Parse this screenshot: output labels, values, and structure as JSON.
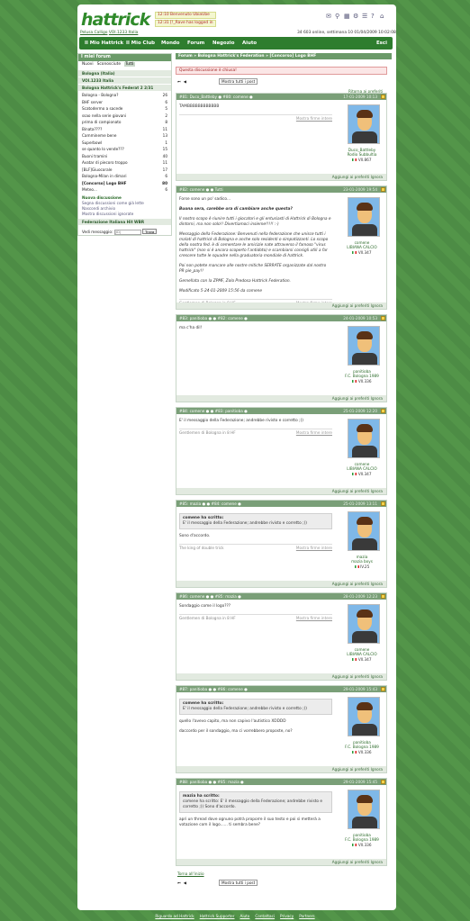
{
  "header": {
    "logo": "hattrick",
    "news": [
      "12:10 Benvenuto UbiaUbe",
      "12:31 [!_Rave has logged in"
    ],
    "user_line": {
      "name": "Pelusa Calligo",
      "team": "VOI.1233 Italia"
    },
    "online_text": "34 603 online, settimana 10 01/04/2009 10:02:08"
  },
  "nav": {
    "items": [
      "Il Mio Hattrick",
      "Il Mio Club",
      "Mondo",
      "Forum",
      "Negozio",
      "Aiuto"
    ],
    "exit": "Esci"
  },
  "sidebar": {
    "title": "I miei forum",
    "filters": [
      "Nuovi",
      "Sconosciute",
      "Tutti"
    ],
    "groups": [
      "Bologna (Italia)",
      "VOI.1233 Italia",
      "Bologna Hattrick's Federat 2 2/31"
    ],
    "threads": [
      {
        "t": "Bologna - Bologna?",
        "n": "26"
      },
      {
        "t": "BHF server",
        "n": "6"
      },
      {
        "t": "Scatodermo a sacede",
        "n": "5"
      },
      {
        "t": "ssao nella serie giovani",
        "n": "2"
      },
      {
        "t": "prima di campionato",
        "n": "8"
      },
      {
        "t": "Binata????",
        "n": "11"
      },
      {
        "t": "Cammineme bene",
        "n": "13"
      },
      {
        "t": "Superbowl",
        "n": "1"
      },
      {
        "t": "se quanto lo vende???",
        "n": "15"
      },
      {
        "t": "Buoni tramini",
        "n": "40"
      },
      {
        "t": "Avatar di piecoro troppo",
        "n": "11"
      },
      {
        "t": "[BLF]Giuocorale",
        "n": "17"
      },
      {
        "t": "Bologna-Milan in dimari",
        "n": "6"
      },
      {
        "t": "[Concorso] Logo BHF",
        "n": "80"
      },
      {
        "t": "Meteo...",
        "n": "6"
      }
    ],
    "links": [
      "Nuova discussione",
      "Segna discussioni come già lette",
      "Nascondi archivio",
      "Mostra discussioni ignorate"
    ],
    "fed": "Federazione Italiana Hit WBR",
    "vedi": "Vedi messaggio:",
    "vedi_ph": "(ID)",
    "vedi_btn": "Trova"
  },
  "breadcrumb": "Forum » Bologna Hattrick's Federation » [Concorso] Logo BHF",
  "alert": "Questa discussione è chiusa!",
  "pager": {
    "label": "Mostra tutti i post",
    "top": "Ritorna ai preferiti"
  },
  "posts": [
    {
      "h": "#81: Duco_Battleby ● #80: comene ●",
      "d": "17-01-2009 10:13",
      "body": [
        "TAMBBBBBBBBBBBB"
      ],
      "sig": "",
      "name": "Duco_Battleby",
      "team": "Rodio Subbultia",
      "team2": "VII.867",
      "foot": "Aggiungi ai preferiti  Ignora"
    },
    {
      "h": "#82: comene ● ● Tutti",
      "d": "23-01-2009 19:54",
      "body": [
        "Forse sono un po' sadico...",
        "Buona sera, carebbe ora di cambiare anche questa?",
        "Il nostro scopo è riunire tutti i giocatori e gli entusiasti di Hattrick di Bologna e dintorni, ma non solo!! Divertiamoci insieme!!!!! :-)",
        "Messaggio della Federazione: Benvenuti nella federazione che unisce tutti i malati di hattrick di Bologna e anche solo residenti o simpatizzanti. Lo scopo della nostra fed. è di cementare le amicizie nate attraverso il famoso \"virus hattrick\" (non si è ancora scoperto l'antidoto) e scambiarsi consigli utili a far crescere tutte le squadre nella graduatoria mondiale di hattrick.",
        "Poi non potete mancare alle nostre mitiche SERRATE organizzate dal nostro PR pie_pay!!",
        "Gemellata con la ZPMF, Zolo Predosa Hattrick Federation.",
        "Modificato 5-24-01-2009 15:56 da comene"
      ],
      "sig": "Gentlemen di Bologna in 8 HF",
      "name": "comene",
      "team": "LIBIANA CALCIO",
      "team2": "VII.347",
      "foot": "Aggiungi ai preferiti  Ignora"
    },
    {
      "h": "#83: panitioba ● ● #82: comene ●",
      "d": "24-01-2009 10:53",
      "body": [
        "ma c'ha dil!"
      ],
      "sig": "",
      "name": "panitioba",
      "team": "F.C. Bologna 1989",
      "team2": "VII.336",
      "foot": "Aggiungi ai preferiti  Ignora"
    },
    {
      "h": "#84: comene ● ● #83: panitioba ●",
      "d": "25-01-2009 12:20",
      "body": [
        "E' il messaggio della Federazione; andrebbe rivisto e corretto ;))"
      ],
      "sig": "Gentlemen di Bologna in 8 HF",
      "name": "comene",
      "team": "LIBIANA CALCIO",
      "team2": "VII.347",
      "foot": "Aggiungi ai preferiti  Ignora"
    },
    {
      "h": "#85: mazia ● ● #84: comene ●",
      "d": "25-01-2009 13:11",
      "quote": {
        "t": "comene ha scritto:",
        "b": "E' il messaggio della Federazione; andrebbe rivisto e corretto ;))"
      },
      "body": [
        "Sono d'accordo."
      ],
      "sig": "The king of double trick",
      "name": "mazia",
      "team": "mazia boys",
      "team2": "IV.25",
      "foot": "Aggiungi ai preferiti  Ignora"
    },
    {
      "h": "#86: comene ● ● #85: mazia ●",
      "d": "28-01-2009 12:23",
      "body": [
        "Sondaggio come il logo???"
      ],
      "sig": "Gentlemen di Bologna in 8 HF",
      "name": "comene",
      "team": "LIBIANA CALCIO",
      "team2": "VII.347",
      "foot": "Aggiungi ai preferiti  Ignora"
    },
    {
      "h": "#87: panitioba ● ● #86: comene ●",
      "d": "29-01-2009 15:43",
      "quote": {
        "t": "comene ha scritto:",
        "b": "E' il messaggio della Federazione; andrebbe rivisto e corretto ;))"
      },
      "body": [
        "quello l'avevo capito, ma non capivo l'autistico XDDDD",
        "daccordo per il sondaggio, ma ci vorrebbero proposte, no?"
      ],
      "sig": "",
      "name": "panitioba",
      "team": "F.C. Bologna 1989",
      "team2": "VII.336",
      "foot": "Aggiungi ai preferiti  Ignora"
    },
    {
      "h": "#88: panitioba ● ● #85: mazia ●",
      "d": "29-01-2009 15:45",
      "quote": {
        "t": "mazia ha scritto:",
        "b": "comene ha scritto: E' il messaggio della Federazione; andrebbe rivisto e corretto ;)) Sono d'accordo."
      },
      "body": [
        "apri un thread dove ognuno potrà proporre il suo testo e poi si metterà a votazione com il logo...... ti sembra bene?"
      ],
      "sig": "",
      "name": "panitioba",
      "team": "F.C. Bologna 1989",
      "team2": "VII.336",
      "foot": "Aggiungi ai preferiti  Ignora"
    }
  ],
  "bottom_link": "Torna all'inizio",
  "footer": [
    "Riguardo ad Hattrick",
    "Hattrick Supporter",
    "Aiuto",
    "Contattaci",
    "Privacy",
    "Partners"
  ]
}
